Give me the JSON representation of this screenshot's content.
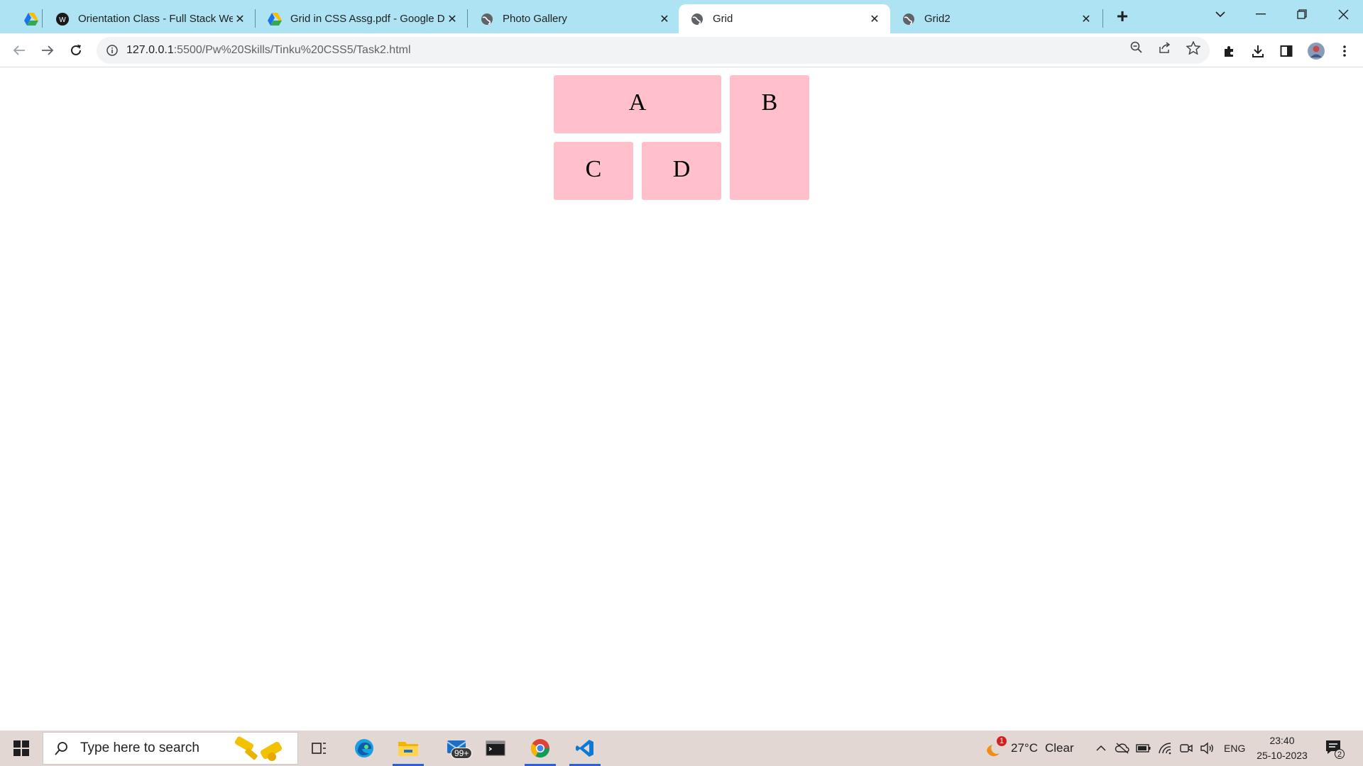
{
  "browser": {
    "tabs": [
      {
        "title": "",
        "favicon": "google-drive-icon",
        "active": false
      },
      {
        "title": "Orientation Class - Full Stack We",
        "favicon": "pw-skills-icon",
        "active": false
      },
      {
        "title": "Grid in CSS Assg.pdf - Google D",
        "favicon": "google-drive-icon",
        "active": false
      },
      {
        "title": "Photo Gallery",
        "favicon": "globe-icon",
        "active": false
      },
      {
        "title": "Grid",
        "favicon": "globe-icon",
        "active": true
      },
      {
        "title": "Grid2",
        "favicon": "globe-icon",
        "active": false
      }
    ],
    "new_tab_label": "+",
    "address": {
      "host": "127.0.0.1",
      "path": ":5500/Pw%20Skills/Tinku%20CSS5/Task2.html"
    },
    "colors": {
      "tab_strip": "#aee3f3",
      "active_tab": "#ffffff"
    }
  },
  "page": {
    "cells": {
      "a": "A",
      "b": "B",
      "c": "C",
      "d": "D"
    },
    "cell_color": "#ffc0cb"
  },
  "taskbar": {
    "search_placeholder": "Type here to search",
    "mail_badge": "99+",
    "weather": {
      "temp": "27°C",
      "condition": "Clear",
      "alert_badge": "1"
    },
    "language": "ENG",
    "time": "23:40",
    "date": "25-10-2023",
    "notification_count": "2"
  }
}
